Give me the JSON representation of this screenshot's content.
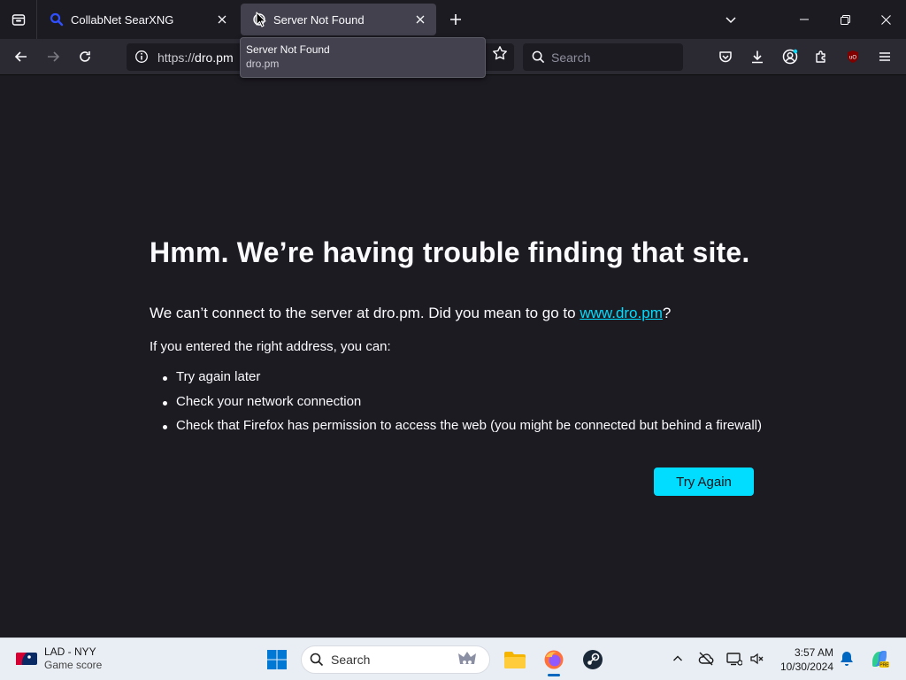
{
  "tabs": [
    {
      "title": "CollabNet SearXNG"
    },
    {
      "title": "Server Not Found"
    }
  ],
  "navbar": {
    "url_scheme": "https://",
    "url_host": "dro.pm",
    "search_placeholder": "Search"
  },
  "tooltip": {
    "title": "Server Not Found",
    "url": "dro.pm"
  },
  "error_page": {
    "title": "Hmm. We’re having trouble finding that site.",
    "desc_prefix": "We can’t connect to the server at dro.pm. Did you mean to go to ",
    "desc_link": "www.dro.pm",
    "desc_suffix": "?",
    "subhead": "If you entered the right address, you can:",
    "suggestions": [
      "Try again later",
      "Check your network connection",
      "Check that Firefox has permission to access the web (you might be connected but behind a firewall)"
    ],
    "button_label": "Try Again"
  },
  "taskbar": {
    "weather_line1": "LAD - NYY",
    "weather_line2": "Game score",
    "search_placeholder": "Search",
    "time": "3:57 AM",
    "date": "10/30/2024"
  },
  "colors": {
    "accent": "#00ddff",
    "page_bg": "#1c1b22",
    "toolbar_bg": "#2b2a33"
  }
}
